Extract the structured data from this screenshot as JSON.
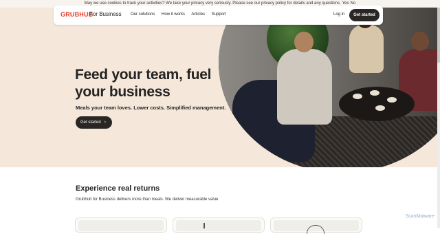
{
  "cookie_banner": {
    "text": "May we use cookies to track your activities? We take your privacy very seriously. Please see our privacy policy for details and any questions.",
    "yes": "Yes",
    "no": "No"
  },
  "nav": {
    "logo": "GRUBHUB",
    "logo_sub": "For Business",
    "links": [
      "Our solutions",
      "How it works",
      "Articles",
      "Support"
    ],
    "login": "Log in",
    "cta": "Get started"
  },
  "hero": {
    "headline_line1": "Feed your team, fuel",
    "headline_line2": "your business",
    "subtitle": "Meals your team loves. Lower costs. Simplified management.",
    "cta": "Get started",
    "cta_icon": "chevron-right-icon"
  },
  "returns": {
    "title": "Experience real returns",
    "subtitle": "Grubhub for Business delivers more than meals. We deliver measurable value."
  },
  "watermark": "ScanMalware",
  "colors": {
    "brand": "#e23a25",
    "hero_bg": "#f5e8da",
    "button_bg": "#2a2623"
  }
}
